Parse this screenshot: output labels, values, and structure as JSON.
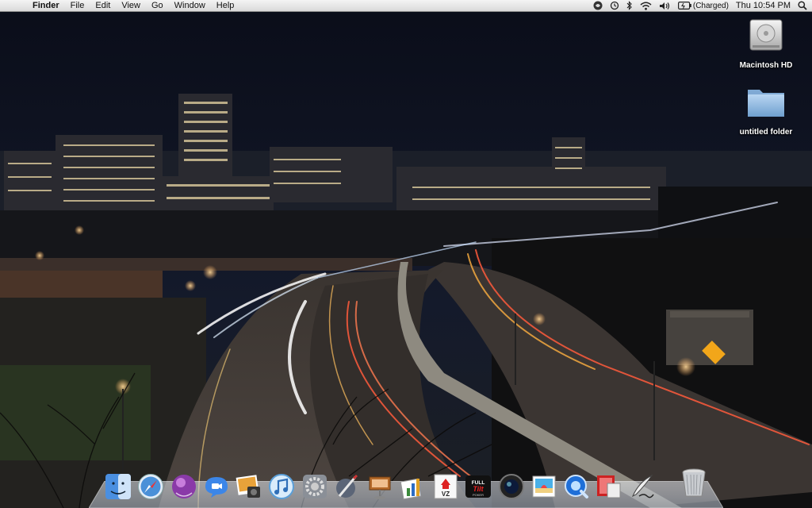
{
  "menubar": {
    "apple_glyph": "",
    "items": [
      "Finder",
      "File",
      "Edit",
      "View",
      "Go",
      "Window",
      "Help"
    ],
    "battery_status": "(Charged)",
    "clock": "Thu 10:54 PM"
  },
  "desktop": {
    "icons": [
      {
        "label": "Macintosh HD",
        "icon": "hard-drive-icon"
      },
      {
        "label": "untitled folder",
        "icon": "folder-icon"
      }
    ]
  },
  "dock": {
    "apps": [
      "finder-icon",
      "safari-icon",
      "itunes-visualizer-icon",
      "ichat-icon",
      "iphoto-icon",
      "itunes-icon",
      "system-preferences-icon",
      "script-editor-icon",
      "keynote-icon",
      "grapher-icon",
      "vz-app-icon",
      "full-tilt-poker-icon",
      "photo-booth-icon",
      "preview-icon",
      "quicktime-icon",
      "photo-app-icon",
      "script-icon"
    ],
    "trash": "trash-icon"
  },
  "colors": {
    "sky": "#0b0f1c",
    "menubar": "#e6e6e6",
    "folder_blue": "#8fb9e0"
  }
}
